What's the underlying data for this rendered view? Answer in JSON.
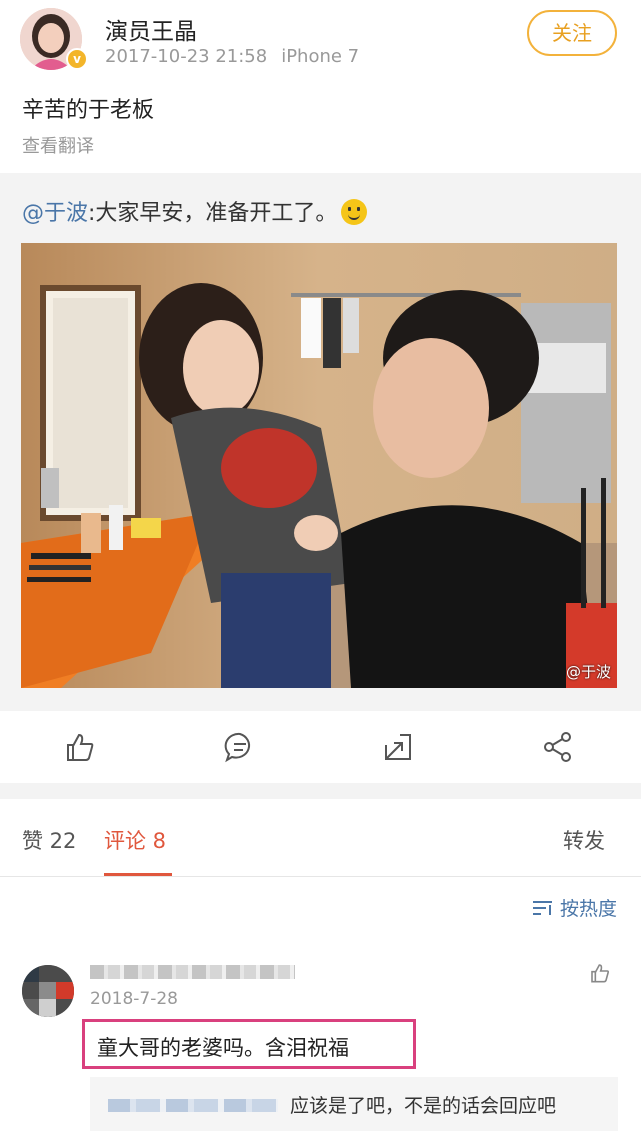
{
  "post": {
    "username": "演员王晶",
    "datetime": "2017-10-23 21:58",
    "device": "iPhone 7",
    "follow_label": "关注",
    "text": "辛苦的于老板",
    "translate_label": "查看翻译"
  },
  "repost": {
    "mention": "@于波",
    "text": ":大家早安，准备开工了。",
    "watermark": "@于波"
  },
  "actions": [
    "like-icon",
    "comment-icon",
    "repost-icon",
    "share-icon"
  ],
  "tabs": {
    "likes": "赞 22",
    "comments": "评论 8",
    "reposts": "转发"
  },
  "sort_label": "按热度",
  "comment": {
    "date": "2018-7-28",
    "text": "童大哥的老婆吗。含泪祝福",
    "reply_text": "应该是了吧，不是的话会回应吧"
  },
  "colors": {
    "accent": "#e0573d",
    "follow": "#e8a021",
    "link": "#4a76a8",
    "highlight_box": "#d9407e"
  }
}
